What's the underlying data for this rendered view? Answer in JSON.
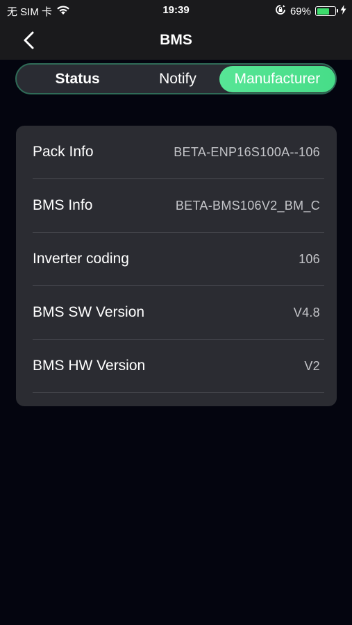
{
  "status_bar": {
    "carrier": "无 SIM 卡",
    "time": "19:39",
    "battery_percent_text": "69%",
    "battery_level": 0.69,
    "icons": [
      "wifi-icon",
      "rotation-lock-icon",
      "battery-icon",
      "charging-bolt-icon"
    ]
  },
  "nav": {
    "title": "BMS",
    "back_icon": "chevron-left-icon"
  },
  "tabs": [
    {
      "label": "Status",
      "selected": false
    },
    {
      "label": "Notify",
      "selected": false
    },
    {
      "label": "Manufacturer",
      "selected": true
    }
  ],
  "info": {
    "rows": [
      {
        "label": "Pack Info",
        "value": "BETA-ENP16S100A--106"
      },
      {
        "label": "BMS Info",
        "value": "BETA-BMS106V2_BM_C"
      },
      {
        "label": "Inverter coding",
        "value": "106"
      },
      {
        "label": "BMS SW Version",
        "value": "V4.8"
      },
      {
        "label": "BMS HW Version",
        "value": "V2"
      }
    ]
  },
  "colors": {
    "accent": "#4ee38f",
    "background": "#04050f",
    "card": "#2b2c32",
    "bar": "#1a1a1c"
  }
}
